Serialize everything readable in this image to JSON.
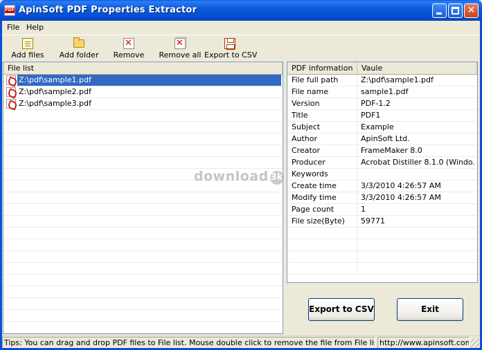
{
  "window": {
    "title": "ApinSoft PDF Properties Extractor",
    "close_glyph": "✕"
  },
  "menu": {
    "file": "File",
    "help": "Help"
  },
  "toolbar": {
    "add_files": "Add files",
    "add_folder": "Add folder",
    "remove": "Remove",
    "remove_all": "Remove all",
    "export_csv": "Export to CSV"
  },
  "file_list": {
    "header": "File list",
    "items": [
      "Z:\\pdf\\sample1.pdf",
      "Z:\\pdf\\sample2.pdf",
      "Z:\\pdf\\sample3.pdf"
    ],
    "selected_index": 0
  },
  "pdf_info": {
    "headers": [
      "PDF information",
      "Vaule"
    ],
    "rows": [
      [
        "File full path",
        "Z:\\pdf\\sample1.pdf"
      ],
      [
        "File name",
        "sample1.pdf"
      ],
      [
        "Version",
        "PDF-1.2"
      ],
      [
        "Title",
        "PDF1"
      ],
      [
        "Subject",
        "Example"
      ],
      [
        "Author",
        "ApinSoft Ltd."
      ],
      [
        "Creator",
        "FrameMaker 8.0"
      ],
      [
        "Producer",
        "Acrobat Distiller 8.1.0 (Windo..."
      ],
      [
        "Keywords",
        ""
      ],
      [
        "Create time",
        "3/3/2010 4:26:57 AM"
      ],
      [
        "Modify time",
        "3/3/2010 4:26:57 AM"
      ],
      [
        "Page count",
        "1"
      ],
      [
        "File size(Byte)",
        "59771"
      ]
    ]
  },
  "buttons": {
    "export_csv": "Export to CSV",
    "exit": "Exit"
  },
  "status": {
    "tips": "Tips: You can drag and drop PDF files to File list. Mouse double click to remove the file from File list.",
    "url": "http://www.apinsoft.com"
  },
  "watermark": {
    "text": "download",
    "badge": "3k"
  }
}
